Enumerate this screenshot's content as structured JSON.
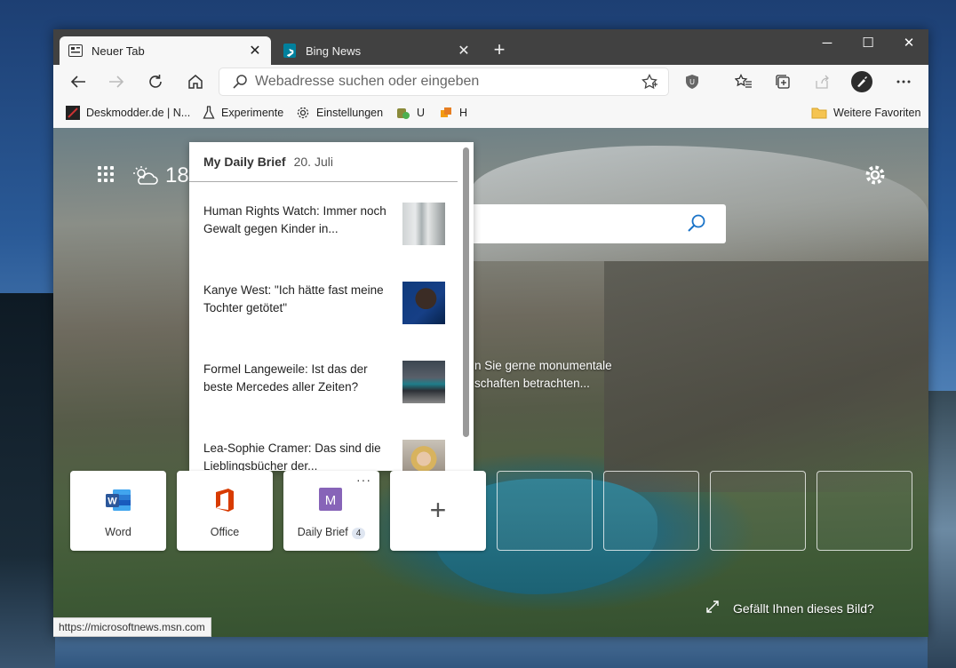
{
  "tabs": [
    {
      "label": "Neuer Tab",
      "icon": "new-tab-icon",
      "active": true
    },
    {
      "label": "Bing News",
      "icon": "bing-icon",
      "active": false
    }
  ],
  "window_controls": {
    "minimize": "─",
    "maximize": "☐",
    "close": "✕"
  },
  "address": {
    "placeholder": "Webadresse suchen oder eingeben"
  },
  "favorites": [
    {
      "label": "Deskmodder.de | N...",
      "icon": "deskmodder-icon"
    },
    {
      "label": "Experimente",
      "icon": "flask-icon"
    },
    {
      "label": "Einstellungen",
      "icon": "gear-icon"
    },
    {
      "label": "U",
      "icon": "extension-u-icon"
    },
    {
      "label": "H",
      "icon": "extension-h-icon"
    }
  ],
  "other_favorites": "Weitere Favoriten",
  "weather": {
    "temp": "18"
  },
  "daily_brief": {
    "title": "My Daily Brief",
    "date": "20. Juli",
    "items": [
      {
        "headline": "Human Rights Watch: Immer noch Gewalt gegen Kinder in..."
      },
      {
        "headline": "Kanye West: \"Ich hätte fast meine Tochter getötet\""
      },
      {
        "headline": "Formel Langeweile: Ist das der beste Mercedes aller Zeiten?"
      },
      {
        "headline": "Lea-Sophie Cramer: Das sind die Lieblingsbücher der..."
      }
    ]
  },
  "caption": {
    "line1": "n Sie gerne monumentale",
    "line2": "schaften betrachten..."
  },
  "tiles": [
    {
      "label": "Word"
    },
    {
      "label": "Office"
    },
    {
      "label": "Daily Brief",
      "badge": "4",
      "more": "···"
    },
    {
      "label": "+"
    }
  ],
  "like_text": "Gefällt Ihnen dieses Bild?",
  "status_url": "https://microsoftnews.msn.com",
  "colors": {
    "titlebar": "#414141",
    "toolbar": "#f7f7f7",
    "accent": "#0a6ac4",
    "word": "#2b579a",
    "office": "#d83b01",
    "daily_brief": "#8764b8"
  }
}
